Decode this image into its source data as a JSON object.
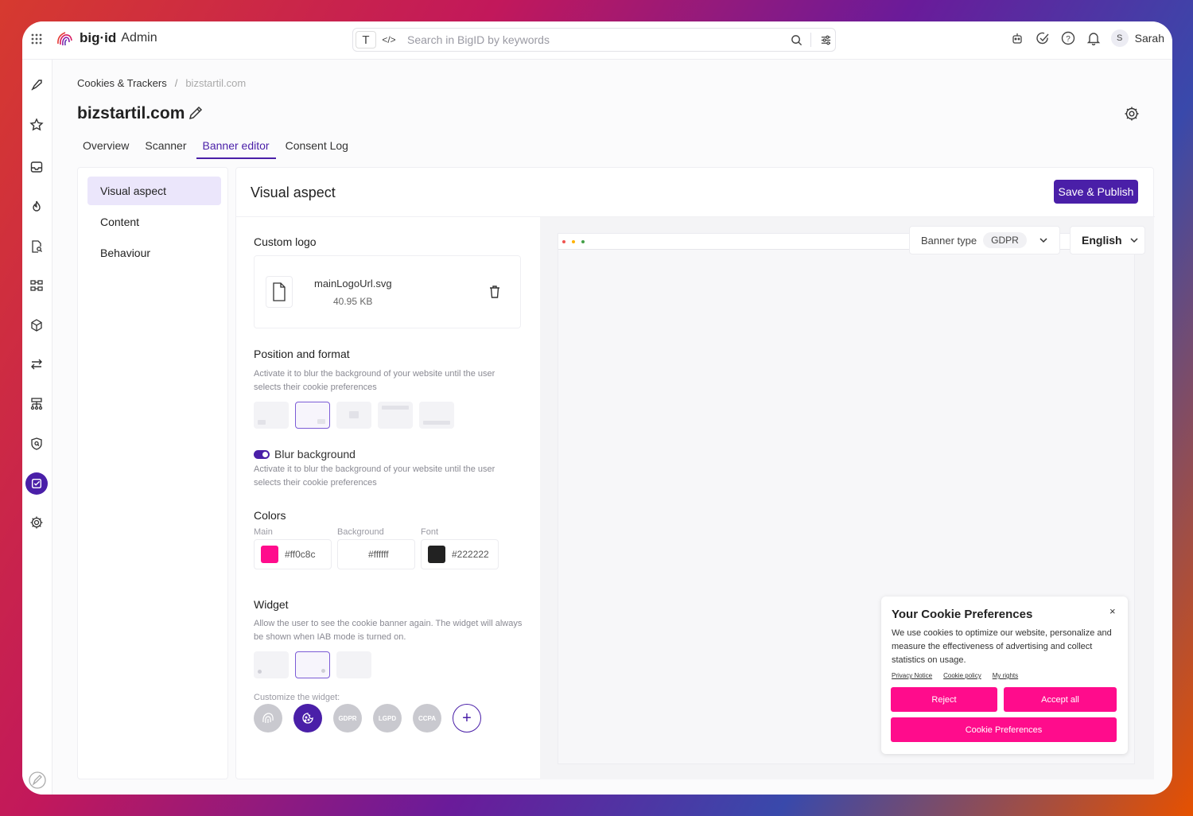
{
  "app": {
    "brand": "big·id",
    "title": "Admin"
  },
  "search": {
    "placeholder": "Search in BigID by keywords",
    "mode_text": "T",
    "mode_code": "</>"
  },
  "user": {
    "initial": "S",
    "name": "Sarah"
  },
  "breadcrumb": {
    "parent": "Cookies & Trackers",
    "separator": "/",
    "current": "bizstartil.com"
  },
  "page": {
    "title": "bizstartil.com"
  },
  "tabs": [
    {
      "label": "Overview"
    },
    {
      "label": "Scanner"
    },
    {
      "label": "Banner editor",
      "active": true
    },
    {
      "label": "Consent Log"
    }
  ],
  "sidenav": [
    {
      "label": "Visual aspect",
      "active": true
    },
    {
      "label": "Content"
    },
    {
      "label": "Behaviour"
    }
  ],
  "panel": {
    "title": "Visual aspect",
    "publish_label": "Save & Publish"
  },
  "form": {
    "logo": {
      "title": "Custom logo",
      "file_name": "mainLogoUrl.svg",
      "file_size": "40.95 KB"
    },
    "position": {
      "title": "Position and format",
      "desc": "Activate it to blur the background of your website until the user selects their cookie preferences",
      "selected_index": 1
    },
    "blur": {
      "label": "Blur background",
      "enabled": true,
      "desc": "Activate it to blur the background of your website until the user selects their cookie preferences"
    },
    "colors": {
      "title": "Colors",
      "main": {
        "label": "Main",
        "value": "#ff0c8c"
      },
      "background": {
        "label": "Background",
        "value": "#ffffff"
      },
      "font": {
        "label": "Font",
        "value": "#222222"
      }
    },
    "widget": {
      "title": "Widget",
      "desc": "Allow the user to see the cookie banner again. The widget will always be shown when IAB mode is turned on.",
      "customize_label": "Customize the widget:",
      "icons": [
        "fingerprint-icon",
        "cookie-icon",
        "GDPR",
        "LGPD",
        "CCPA",
        "+"
      ]
    }
  },
  "preview": {
    "banner_type_label": "Banner type",
    "banner_type_value": "GDPR",
    "language": "English",
    "cookie": {
      "title": "Your Cookie Preferences",
      "close": "×",
      "text": "We use cookies to optimize our website, personalize and measure the effectiveness of advertising and collect statistics on usage.",
      "links": [
        "Privacy Notice",
        "Cookie policy",
        "My rights"
      ],
      "reject": "Reject",
      "accept": "Accept all",
      "preferences": "Cookie Preferences"
    }
  },
  "colors": {
    "accent": "#4a1fa8",
    "cookie_button": "#ff0c8c"
  }
}
